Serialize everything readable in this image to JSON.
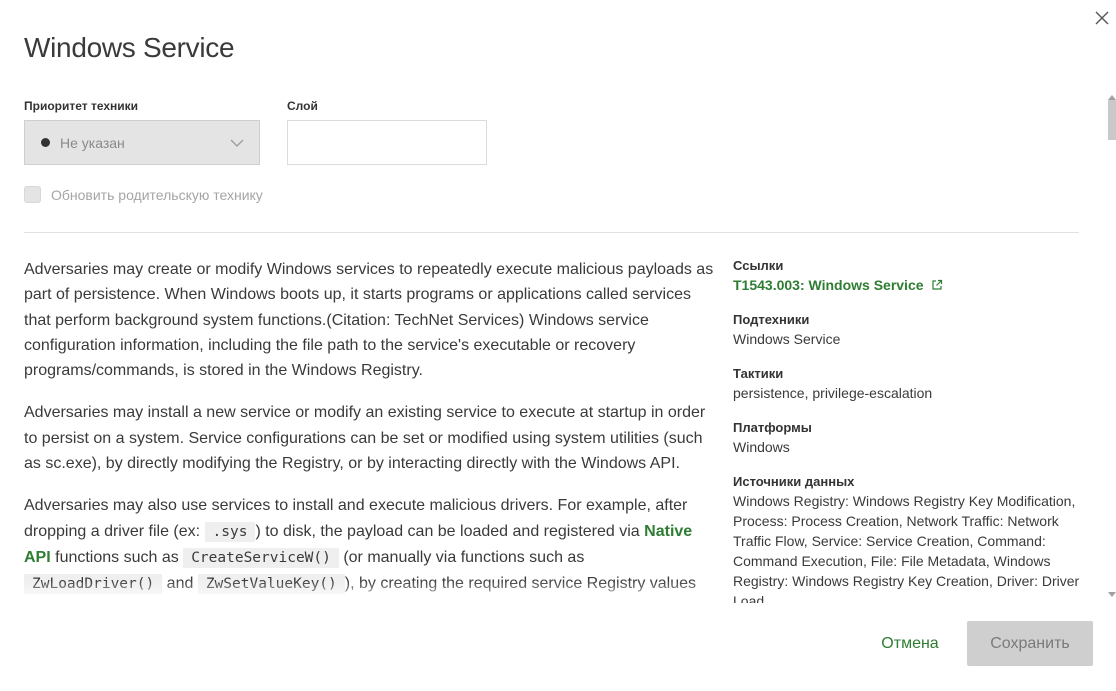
{
  "dialog": {
    "title": "Windows Service"
  },
  "form": {
    "priority_label": "Приоритет техники",
    "priority_value": "Не указан",
    "layer_label": "Слой",
    "layer_value": "",
    "update_parent_label": "Обновить родительскую технику",
    "update_parent_checked": false
  },
  "description": {
    "p1": "Adversaries may create or modify Windows services to repeatedly execute malicious payloads as part of persistence. When Windows boots up, it starts programs or applications called services that perform background system functions.(Citation: TechNet Services) Windows service configuration information, including the file path to the service's executable or recovery programs/commands, is stored in the Windows Registry.",
    "p2": "Adversaries may install a new service or modify an existing service to execute at startup in order to persist on a system. Service configurations can be set or modified using system utilities (such as sc.exe), by directly modifying the Registry, or by interacting directly with the Windows API.",
    "p3_a": "Adversaries may also use services to install and execute malicious drivers. For example, after dropping a driver file (ex: ",
    "p3_code1": ".sys",
    "p3_b": ") to disk, the payload can be loaded and registered via ",
    "p3_link": "Native API",
    "p3_c": " functions such as ",
    "p3_code2": "CreateServiceW()",
    "p3_d": " (or manually via functions such as ",
    "p3_code3": "ZwLoadDriver()",
    "p3_e": " and ",
    "p3_code4": "ZwSetValueKey()",
    "p3_f": "), by creating the required service Registry values"
  },
  "side": {
    "links_label": "Ссылки",
    "links_value": "T1543.003: Windows Service",
    "subtechniques_label": "Подтехники",
    "subtechniques_value": "Windows Service",
    "tactics_label": "Тактики",
    "tactics_value": "persistence, privilege-escalation",
    "platforms_label": "Платформы",
    "platforms_value": "Windows",
    "sources_label": "Источники данных",
    "sources_value": "Windows Registry: Windows Registry Key Modification, Process: Process Creation, Network Traffic: Network Traffic Flow, Service: Service Creation, Command: Command Execution, File: File Metadata, Windows Registry: Windows Registry Key Creation, Driver: Driver Load"
  },
  "actions": {
    "cancel_label": "Отмена",
    "save_label": "Сохранить"
  },
  "colors": {
    "accent": "#2e7d32",
    "disabled_bg": "#cfcfcf"
  },
  "icons": {
    "close": "close-icon",
    "chevron": "chevron-down-icon",
    "external": "external-link-icon"
  }
}
